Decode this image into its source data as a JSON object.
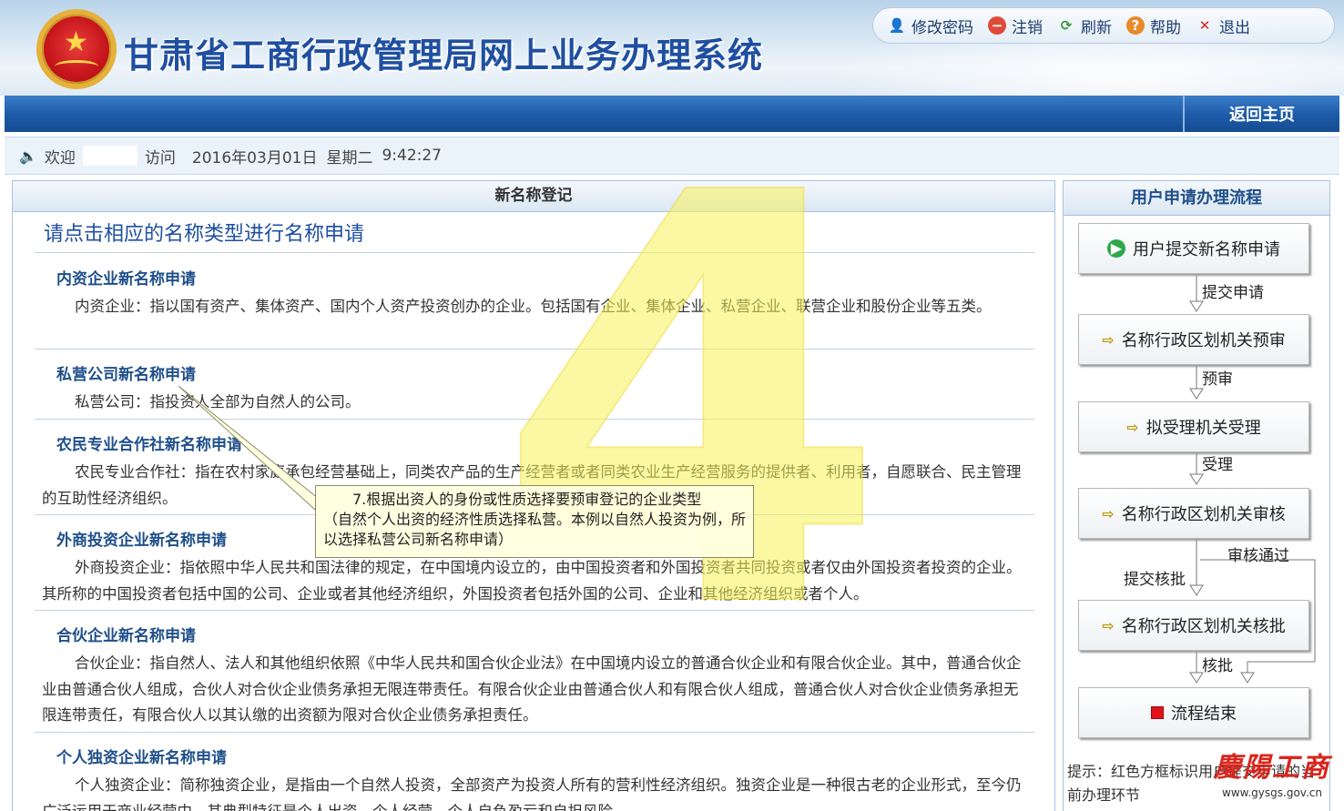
{
  "header": {
    "title": "甘肃省工商行政管理局网上业务办理系统",
    "toolbar": [
      {
        "label": "修改密码",
        "icon": "user-key-icon"
      },
      {
        "label": "注销",
        "icon": "logout-icon"
      },
      {
        "label": "刷新",
        "icon": "refresh-icon"
      },
      {
        "label": "帮助",
        "icon": "help-icon"
      },
      {
        "label": "退出",
        "icon": "exit-icon"
      }
    ]
  },
  "nav": {
    "home_label": "返回主页"
  },
  "welcome": {
    "greet": "欢迎",
    "visit": "访问",
    "date": "2016年03月01日",
    "weekday": "星期二",
    "time": "9:42:27"
  },
  "main": {
    "panel_title": "新名称登记",
    "prompt": "请点击相应的名称类型进行名称申请",
    "types": [
      {
        "title": "内资企业新名称申请",
        "desc": "内资企业：指以国有资产、集体资产、国内个人资产投资创办的企业。包括国有企业、集体企业、私营企业、联营企业和股份企业等五类。"
      },
      {
        "title": "私营公司新名称申请",
        "desc": "私营公司：指投资人全部为自然人的公司。"
      },
      {
        "title": "农民专业合作社新名称申请",
        "desc": "农民专业合作社：指在农村家庭承包经营基础上，同类农产品的生产经营者或者同类农业生产经营服务的提供者、利用者，自愿联合、民主管理的互助性经济组织。"
      },
      {
        "title": "外商投资企业新名称申请",
        "desc": "外商投资企业：指依照中华人民共和国法律的规定，在中国境内设立的，由中国投资者和外国投资者共同投资或者仅由外国投资者投资的企业。其所称的中国投资者包括中国的公司、企业或者其他经济组织，外国投资者包括外国的公司、企业和其他经济组织或者个人。"
      },
      {
        "title": "合伙企业新名称申请",
        "desc": "合伙企业：指自然人、法人和其他组织依照《中华人民共和国合伙企业法》在中国境内设立的普通合伙企业和有限合伙企业。其中，普通合伙企业由普通合伙人组成，合伙人对合伙企业债务承担无限连带责任。有限合伙企业由普通合伙人和有限合伙人组成，普通合伙人对合伙企业债务承担无限连带责任，有限合伙人以其认缴的出资额为限对合伙企业债务承担责任。"
      },
      {
        "title": "个人独资企业新名称申请",
        "desc": "个人独资企业：简称独资企业，是指由一个自然人投资，全部资产为投资人所有的营利性经济组织。独资企业是一种很古老的企业形式，至今仍广泛运用于商业经营中，其典型特征是个人出资、个人经营、个人自负盈亏和自担风险。"
      }
    ]
  },
  "annotation": {
    "step_number": "4",
    "callout_line1": "7.根据出资人的身份或性质选择要预审登记的企业类型",
    "callout_line2": "（自然个人出资的经济性质选择私营。本例以自然人投资为例，所以选择私营公司新名称申请）"
  },
  "flow": {
    "title": "用户申请办理流程",
    "steps": [
      {
        "label": "用户提交新名称申请",
        "icon": "play-icon"
      },
      {
        "label": "名称行政区划机关预审",
        "icon": "arrow-icon"
      },
      {
        "label": "拟受理机关受理",
        "icon": "arrow-icon"
      },
      {
        "label": "名称行政区划机关审核",
        "icon": "arrow-icon"
      },
      {
        "label": "名称行政区划机关核批",
        "icon": "arrow-icon"
      },
      {
        "label": "流程结束",
        "icon": "stop-icon"
      }
    ],
    "labels": [
      "提交申请",
      "预审",
      "受理",
      "审核通过",
      "提交核批",
      "核批"
    ],
    "hint": "提示：红色方框标识用户提交申请的当前办理环节"
  },
  "corner_logo": {
    "text": "慶陽工商",
    "url": "www.gysgs.gov.cn"
  }
}
